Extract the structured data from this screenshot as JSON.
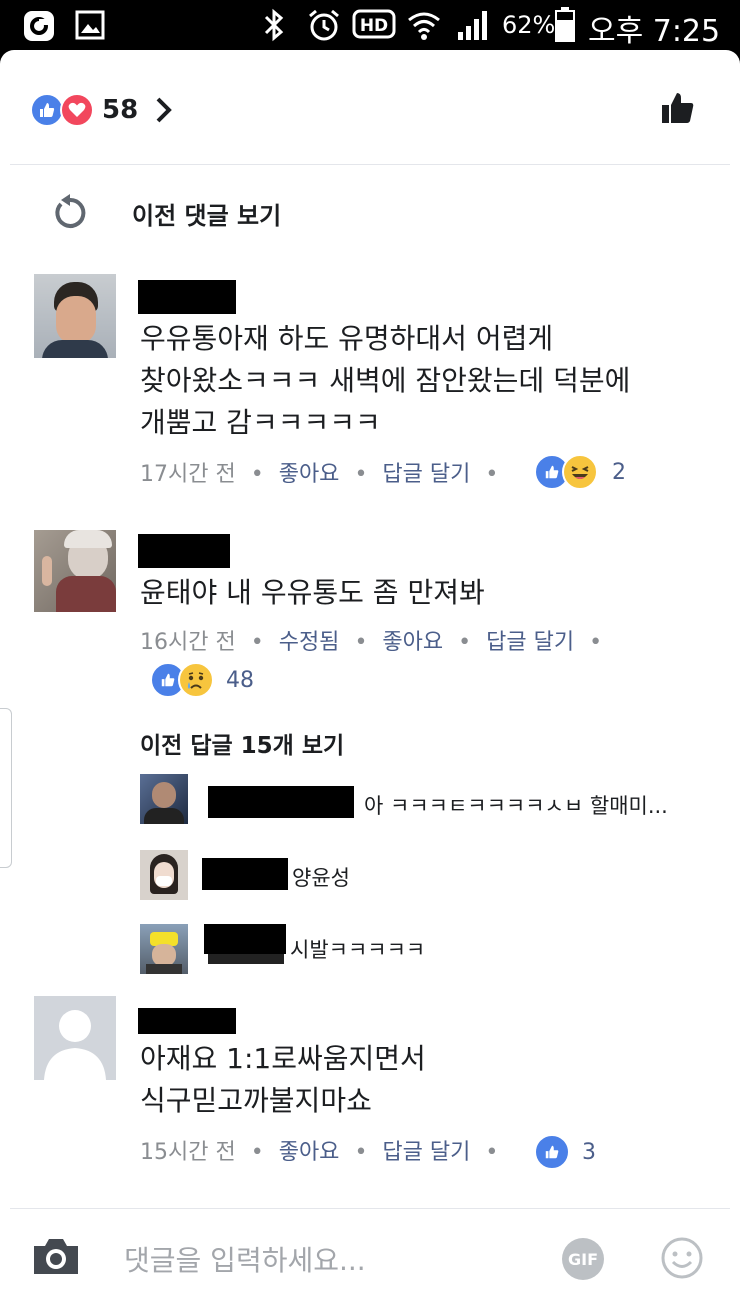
{
  "status_bar": {
    "battery": "62%",
    "time": "오후 7:25",
    "icons": [
      "o-app-icon",
      "gallery-icon",
      "bluetooth-icon",
      "alarm-icon",
      "hd-voice-icon",
      "wifi-icon",
      "signal-icon",
      "battery-icon"
    ]
  },
  "header": {
    "reaction_count": "58",
    "reaction_icons": [
      "like-icon",
      "love-icon"
    ]
  },
  "previous_comments_label": "이전 댓글 보기",
  "comments": [
    {
      "text_lines": [
        "우유통아재 하도 유명하대서 어렵게",
        "찾아왔소ㅋㅋㅋ 새벽에 잠안왔는데 덕분에",
        "개뿜고 감ㅋㅋㅋㅋㅋ"
      ],
      "time": "17시간 전",
      "like": "좋아요",
      "reply": "답글 달기",
      "reaction_count": "2",
      "reactions": [
        "like-icon",
        "haha-icon"
      ]
    },
    {
      "text_lines": [
        "윤태야 내 우유통도 좀 만져봐"
      ],
      "time": "16시간 전",
      "edited": "수정됨",
      "like": "좋아요",
      "reply": "답글 달기",
      "reaction_count": "48",
      "reactions": [
        "like-icon",
        "sad-icon"
      ]
    },
    {
      "text_lines": [
        "아재요 1:1로싸움지면서",
        "식구믿고까불지마쇼"
      ],
      "time": "15시간 전",
      "like": "좋아요",
      "reply": "답글 달기",
      "reaction_count": "3",
      "reactions": [
        "like-icon"
      ]
    }
  ],
  "replies_section": {
    "previous_replies_label": "이전 답글 15개 보기",
    "replies": [
      {
        "text": "아 ㅋㅋㅋㅌㅋㅋㅋㅋㅅㅂ 할매미..."
      },
      {
        "text": "양윤성"
      },
      {
        "text": "시발ㅋㅋㅋㅋㅋ"
      }
    ]
  },
  "composer": {
    "placeholder": "댓글을 입력하세요...",
    "gif_label": "GIF"
  },
  "colors": {
    "accent": "#4a80e8",
    "love": "#f2475d",
    "text": "#1c1e21",
    "meta": "#8a8d91"
  }
}
